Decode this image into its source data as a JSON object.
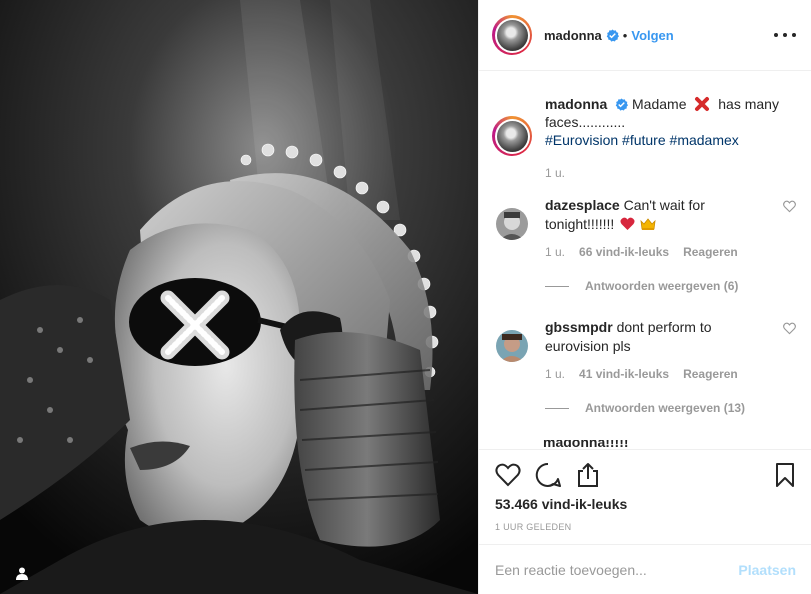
{
  "post": {
    "username": "madonna",
    "dot": "•",
    "follow_label": "Volgen"
  },
  "caption": {
    "username": "madonna",
    "text_before": "Madame",
    "text_after": "has many faces............",
    "hashtags": [
      "#Eurovision",
      "#future",
      "#madamex"
    ],
    "time": "1 u."
  },
  "comments": [
    {
      "username": "dazesplace",
      "text": "Can't wait for tonight!!!!!!!",
      "emojis": [
        "heart-emoji",
        "crown-emoji"
      ],
      "time": "1 u.",
      "likes": "66 vind-ik-leuks",
      "reply_label": "Reageren",
      "replies_label": "Antwoorden weergeven (6)"
    },
    {
      "username": "gbssmpdr",
      "text": "dont perform to eurovision pls",
      "time": "1 u.",
      "likes": "41 vind-ik-leuks",
      "reply_label": "Reageren",
      "replies_label": "Antwoorden weergeven (13)"
    }
  ],
  "partial_comment_text": "madonna!!!!! Madame X",
  "actions": {
    "icons": [
      "heart-icon",
      "comment-icon",
      "share-icon",
      "bookmark-icon"
    ]
  },
  "likes_total": "53.466 vind-ik-leuks",
  "posted_ago": "1 UUR GELEDEN",
  "add_comment": {
    "placeholder": "Een reactie toevoegen...",
    "post_label": "Plaatsen"
  },
  "colors": {
    "link_blue": "#3897f0",
    "hashtag": "#003569",
    "muted": "#999999",
    "post_disabled": "#b2dffc"
  }
}
